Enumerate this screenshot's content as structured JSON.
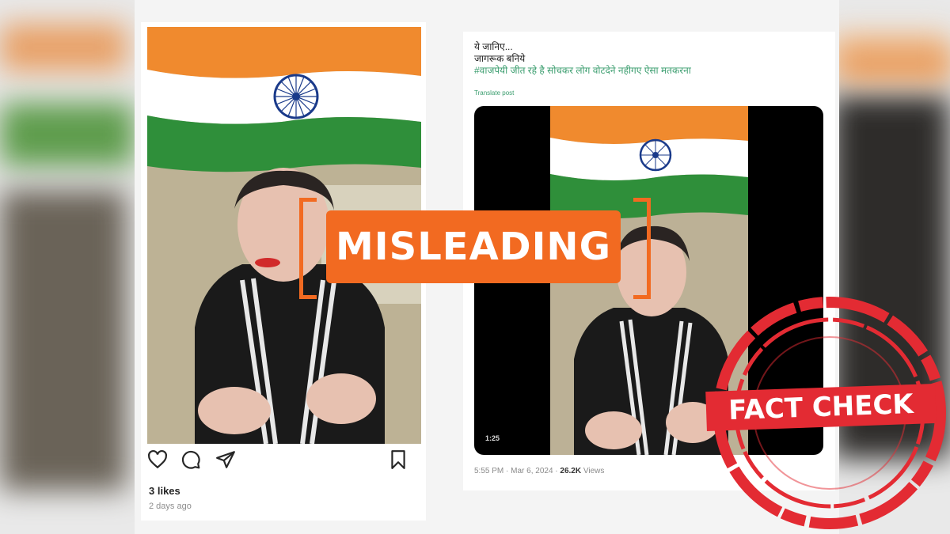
{
  "instagram_post": {
    "likes": "3 likes",
    "timestamp": "2 days ago",
    "icons": [
      "heart-icon",
      "comment-icon",
      "share-icon",
      "bookmark-icon"
    ]
  },
  "tweet": {
    "line1": "ये जानिए...",
    "line2": "जागरूक बनिये",
    "hashtag_line": "#वाजपेयी जीत रहे है सोचकर लोग वोटदेने नहीगए ऐसा मतकरना",
    "translate_label": "Translate post",
    "video_duration": "1:25",
    "time": "5:55 PM",
    "date": "Mar 6, 2024",
    "views_count": "26.2K",
    "views_label": "Views"
  },
  "labels": {
    "rating": "MISLEADING",
    "stamp": "FACT CHECK"
  },
  "colors": {
    "rating_orange": "#f26a21",
    "stamp_red": "#e32b33",
    "flag_saffron": "#f08a2e",
    "flag_green": "#2f8f3a",
    "chakra_navy": "#1a3a8a",
    "hashtag_green": "#3a9d6e"
  }
}
